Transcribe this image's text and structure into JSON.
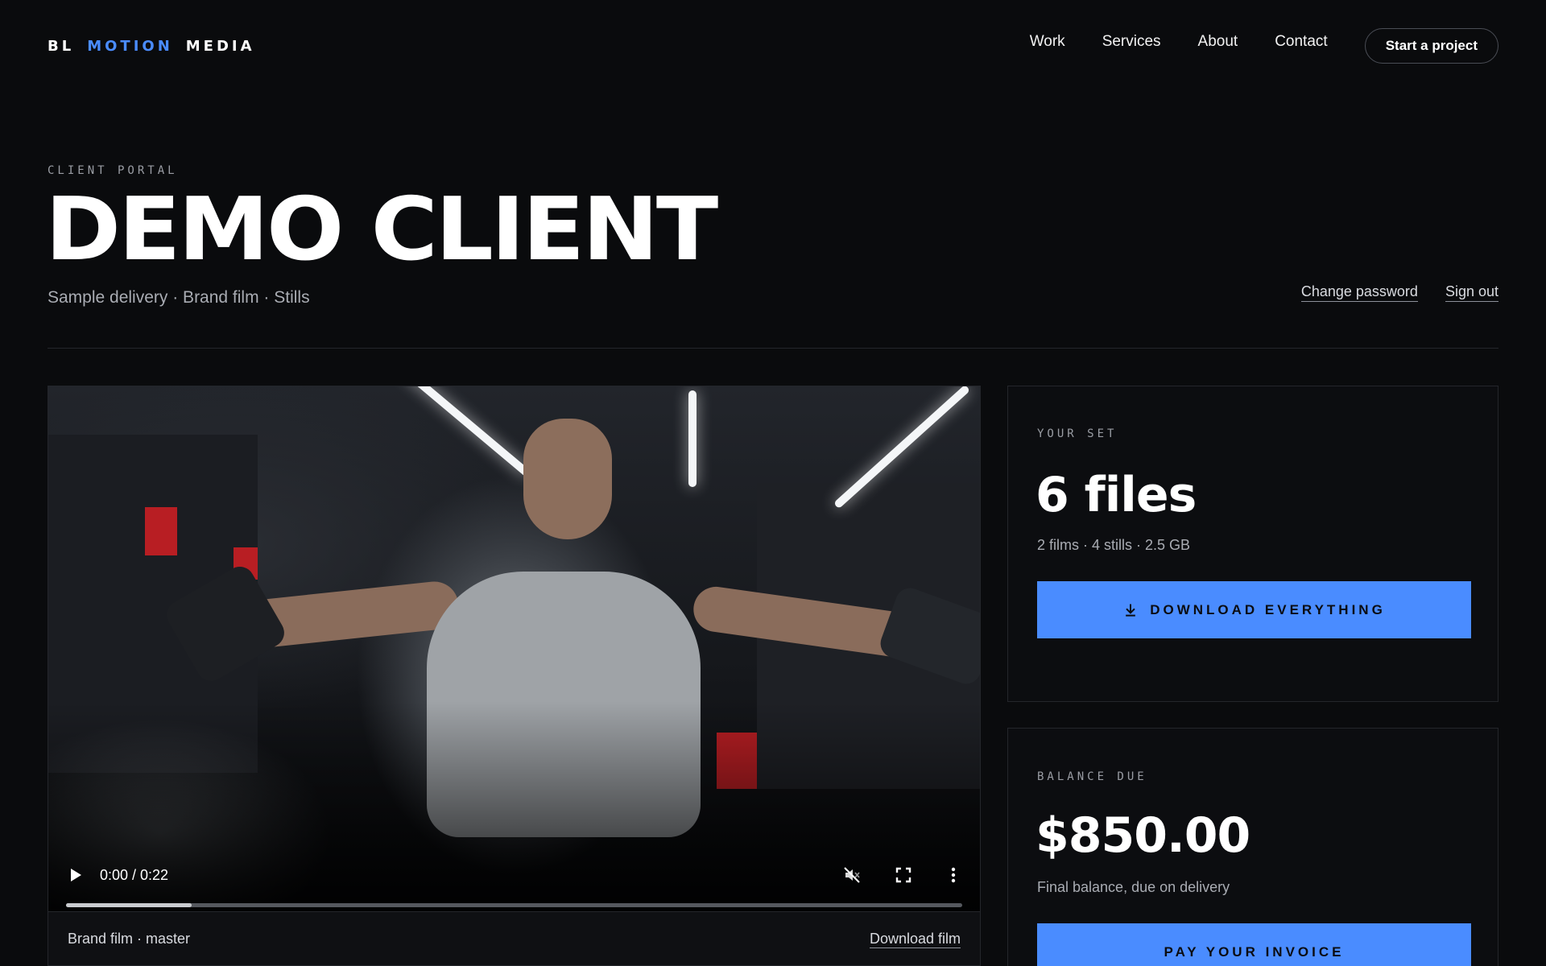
{
  "brand": {
    "part1": "BL",
    "part2": "MOTION",
    "part3": "MEDIA",
    "accent_color": "#4a8cff"
  },
  "nav": {
    "items": [
      {
        "label": "Work"
      },
      {
        "label": "Services"
      },
      {
        "label": "About"
      },
      {
        "label": "Contact"
      }
    ],
    "cta_label": "Start a project"
  },
  "hero": {
    "eyebrow": "CLIENT PORTAL",
    "title": "DEMO CLIENT",
    "subtitle": "Sample delivery · Brand film · Stills",
    "change_password": "Change password",
    "sign_out": "Sign out"
  },
  "video": {
    "time": "0:00 / 0:22",
    "progress": 0.14,
    "caption": "Brand film · master",
    "download_label": "Download film",
    "icons": {
      "play": "play-icon",
      "mute": "mute-icon",
      "fullscreen": "fullscreen-icon",
      "more": "more-icon"
    }
  },
  "set": {
    "label": "YOUR SET",
    "count": "6 files",
    "summary": "2 films · 4 stills · 2.5 GB",
    "button_label": "DOWNLOAD EVERYTHING",
    "button_icon": "download-icon"
  },
  "balance": {
    "label": "BALANCE DUE",
    "amount": "$850.00",
    "note": "Final balance, due on delivery",
    "button_label": "PAY YOUR INVOICE"
  }
}
